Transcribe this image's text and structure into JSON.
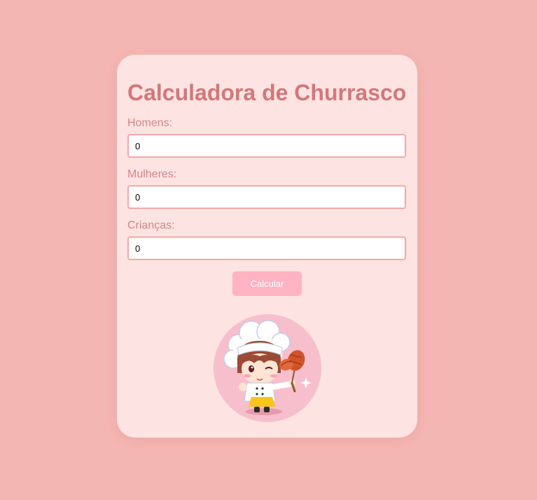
{
  "title": "Calculadora de Churrasco",
  "fields": {
    "homens": {
      "label": "Homens:",
      "value": "0"
    },
    "mulheres": {
      "label": "Mulheres:",
      "value": "0"
    },
    "criancas": {
      "label": "Crianças:",
      "value": "0"
    }
  },
  "button": {
    "label": "Calcular"
  },
  "illustration": {
    "icon": "chef-girl-with-grilled-meat-icon"
  },
  "colors": {
    "background": "#f4b6b2",
    "card": "#fde3e1",
    "title": "#d1787c",
    "button": "#ffb3c3",
    "input_border": "#f1aaa9"
  }
}
